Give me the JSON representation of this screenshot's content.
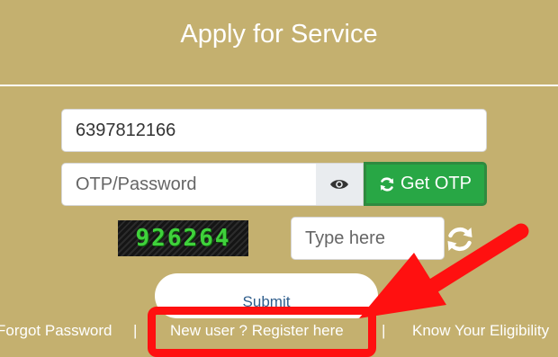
{
  "page": {
    "title": "Apply for Service"
  },
  "form": {
    "mobile_value": "6397812166",
    "password_placeholder": "OTP/Password",
    "get_otp_label": "Get OTP",
    "captcha_code": "926264",
    "captcha_placeholder": "Type here",
    "submit_label": "Submit"
  },
  "footer": {
    "forgot_password": "Forgot Password",
    "separator": "|",
    "register": "New user ? Register here",
    "eligibility": "Know Your Eligibility"
  },
  "icons": {
    "password_toggle": "eye-icon",
    "get_otp": "sync-icon",
    "captcha_refresh": "refresh-icon"
  },
  "colors": {
    "background": "#c4b06f",
    "otp_button": "#28a745",
    "annotation": "#ff1010",
    "captcha_text": "#3fd13b"
  }
}
